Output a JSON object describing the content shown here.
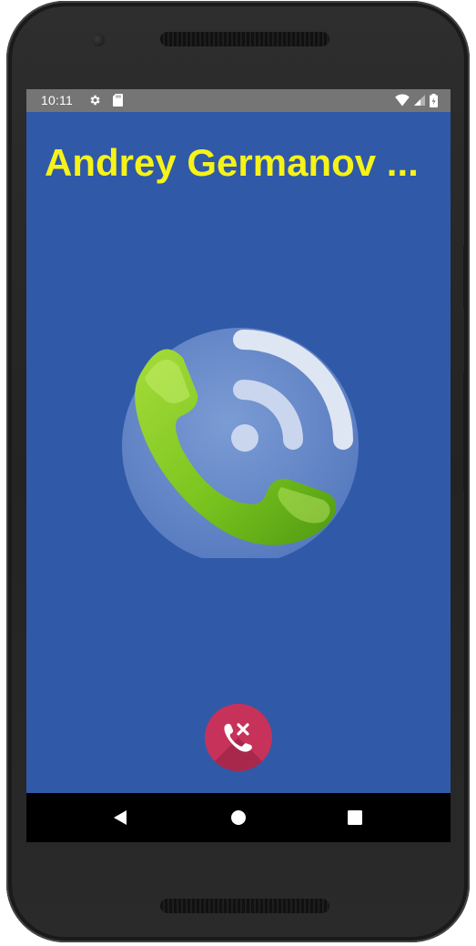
{
  "status_bar": {
    "time": "10:11",
    "left_icons": [
      "gear-icon",
      "sd-card-icon"
    ],
    "right_icons": [
      "wifi-icon",
      "signal-icon",
      "battery-icon"
    ],
    "background": "#757575"
  },
  "call": {
    "caller_name": "Andrey Germanov ...",
    "caller_name_color": "#f6f318",
    "background": "#3059a8",
    "graphic_icon": "green-phone-handset-icon",
    "end_call_icon": "phone-decline-icon",
    "end_call_color": "#c7325a"
  },
  "nav_bar": {
    "buttons": [
      "back-icon",
      "home-icon",
      "recents-icon"
    ],
    "background": "#000000"
  }
}
